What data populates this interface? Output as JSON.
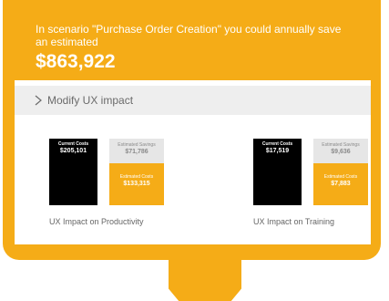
{
  "colors": {
    "accent": "#f5ac17",
    "current_costs_bar": "#000000",
    "savings_bar": "#e6e6e6",
    "panel": "#eeeeee"
  },
  "hero": {
    "text": "In scenario \"Purchase Order Creation\" you could annually save an estimated",
    "amount": "$863,922"
  },
  "modify": {
    "icon": "chevron-right-icon",
    "label": "Modify UX impact"
  },
  "charts": [
    {
      "current": {
        "label": "Current Costs",
        "value": "$205,101"
      },
      "savings": {
        "label": "Estimated Savings",
        "value": "$71,786"
      },
      "estimated": {
        "label": "Estimated Costs",
        "value": "$133,315"
      },
      "caption": "UX Impact on Productivity"
    },
    {
      "current": {
        "label": "Current Costs",
        "value": "$17,519"
      },
      "savings": {
        "label": "Estimated Savings",
        "value": "$9,636"
      },
      "estimated": {
        "label": "Estimated Costs",
        "value": "$7,883"
      },
      "caption": "UX Impact on Training"
    }
  ]
}
